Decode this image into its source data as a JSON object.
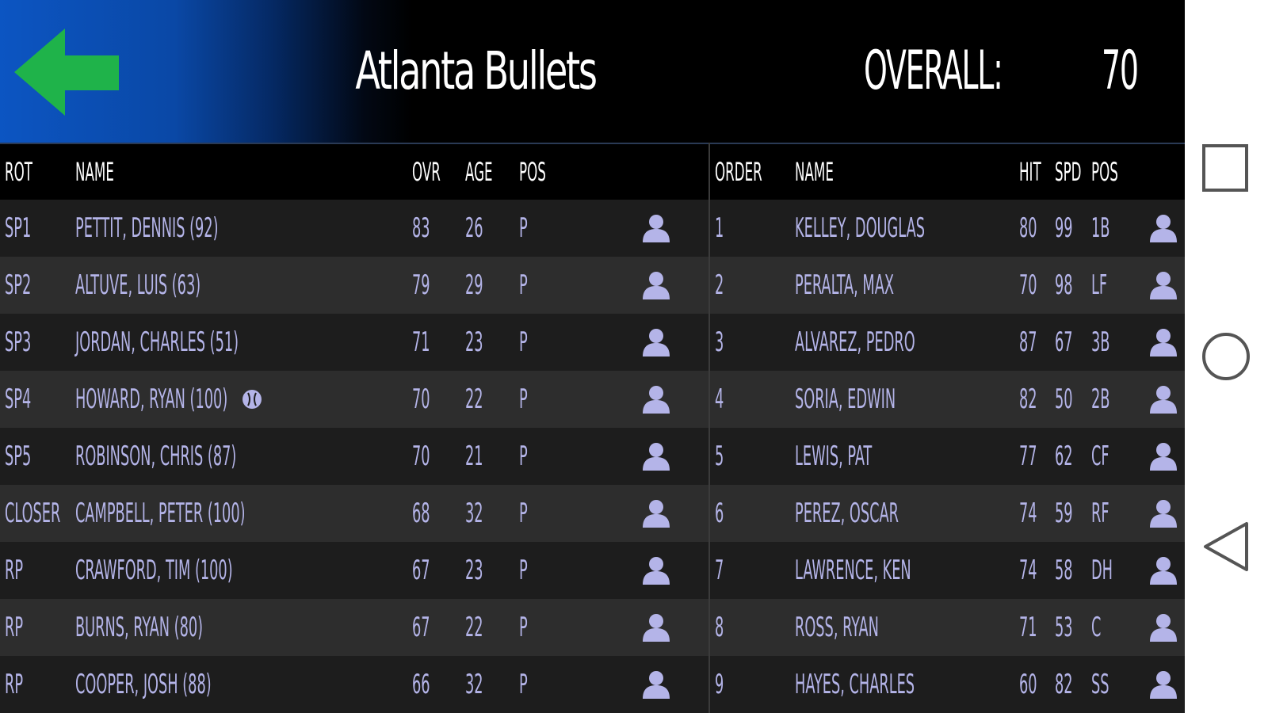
{
  "header": {
    "team_name": "Atlanta Bullets",
    "overall_label": "OVERALL:",
    "overall_value": "70",
    "back_icon": "arrow-left-icon",
    "back_color": "#1fb34a"
  },
  "pitchers": {
    "columns": {
      "rot": "ROT",
      "name": "NAME",
      "ovr": "OVR",
      "age": "AGE",
      "pos": "POS"
    },
    "rows": [
      {
        "rot": "SP1",
        "name": "PETTIT, DENNIS (92)",
        "ovr": "83",
        "age": "26",
        "pos": "P"
      },
      {
        "rot": "SP2",
        "name": "ALTUVE, LUIS (63)",
        "ovr": "79",
        "age": "29",
        "pos": "P"
      },
      {
        "rot": "SP3",
        "name": "JORDAN, CHARLES (51)",
        "ovr": "71",
        "age": "23",
        "pos": "P"
      },
      {
        "rot": "SP4",
        "name": "HOWARD, RYAN (100)",
        "ovr": "70",
        "age": "22",
        "pos": "P",
        "badge": "baseball-icon"
      },
      {
        "rot": "SP5",
        "name": "ROBINSON, CHRIS (87)",
        "ovr": "70",
        "age": "21",
        "pos": "P"
      },
      {
        "rot": "CLOSER",
        "name": "CAMPBELL, PETER (100)",
        "ovr": "68",
        "age": "32",
        "pos": "P"
      },
      {
        "rot": "RP",
        "name": "CRAWFORD, TIM (100)",
        "ovr": "67",
        "age": "23",
        "pos": "P"
      },
      {
        "rot": "RP",
        "name": "BURNS, RYAN (80)",
        "ovr": "67",
        "age": "22",
        "pos": "P"
      },
      {
        "rot": "RP",
        "name": "COOPER, JOSH (88)",
        "ovr": "66",
        "age": "32",
        "pos": "P"
      }
    ]
  },
  "lineup": {
    "columns": {
      "order": "ORDER",
      "name": "NAME",
      "hit": "HIT",
      "spd": "SPD",
      "pos": "POS"
    },
    "rows": [
      {
        "order": "1",
        "name": "KELLEY, DOUGLAS",
        "hit": "80",
        "spd": "99",
        "pos": "1B"
      },
      {
        "order": "2",
        "name": "PERALTA, MAX",
        "hit": "70",
        "spd": "98",
        "pos": "LF"
      },
      {
        "order": "3",
        "name": "ALVAREZ, PEDRO",
        "hit": "87",
        "spd": "67",
        "pos": "3B"
      },
      {
        "order": "4",
        "name": "SORIA, EDWIN",
        "hit": "82",
        "spd": "50",
        "pos": "2B"
      },
      {
        "order": "5",
        "name": "LEWIS, PAT",
        "hit": "77",
        "spd": "62",
        "pos": "CF"
      },
      {
        "order": "6",
        "name": "PEREZ, OSCAR",
        "hit": "74",
        "spd": "59",
        "pos": "RF"
      },
      {
        "order": "7",
        "name": "LAWRENCE, KEN",
        "hit": "74",
        "spd": "58",
        "pos": "DH"
      },
      {
        "order": "8",
        "name": "ROSS, RYAN",
        "hit": "71",
        "spd": "53",
        "pos": "C"
      },
      {
        "order": "9",
        "name": "HAYES, CHARLES",
        "hit": "60",
        "spd": "82",
        "pos": "SS"
      }
    ]
  },
  "row_icon": "person-icon",
  "icon_color": "#b4b4e8",
  "nav": {
    "recents_icon": "square-recents-icon",
    "home_icon": "circle-home-icon",
    "back_icon": "triangle-back-icon"
  }
}
